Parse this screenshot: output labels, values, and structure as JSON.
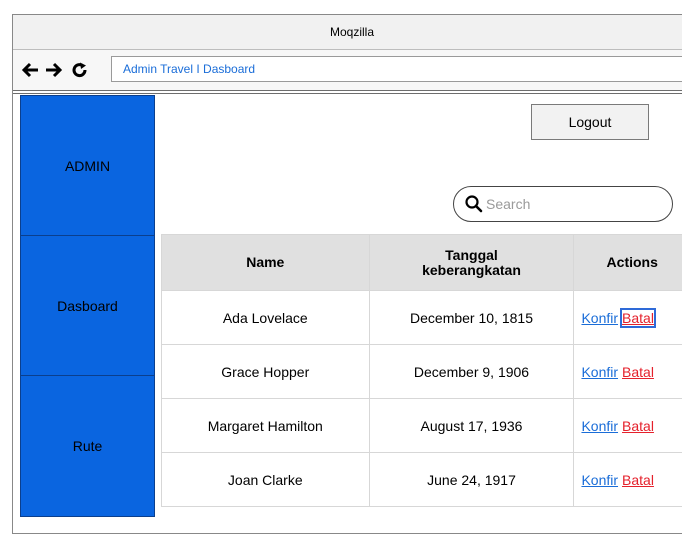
{
  "window": {
    "title": "Moqzilla"
  },
  "nav": {
    "back_icon": "back-arrow-icon",
    "forward_icon": "forward-arrow-icon",
    "reload_icon": "reload-icon",
    "address": "Admin Travel I Dasboard"
  },
  "sidebar": {
    "items": [
      {
        "label": "ADMIN"
      },
      {
        "label": "Dasboard"
      },
      {
        "label": "Rute"
      }
    ],
    "color": "#0a65e0"
  },
  "header": {
    "logout_label": "Logout"
  },
  "search": {
    "placeholder": "Search",
    "value": ""
  },
  "table": {
    "columns": [
      "Name",
      "Tanggal keberangkatan",
      "Actions"
    ],
    "rows": [
      {
        "name": "Ada Lovelace",
        "date": "December 10, 1815",
        "confirm": "Konfir",
        "cancel": "Batal"
      },
      {
        "name": "Grace Hopper",
        "date": "December 9, 1906",
        "confirm": "Konfir",
        "cancel": "Batal"
      },
      {
        "name": "Margaret Hamilton",
        "date": "August 17, 1936",
        "confirm": "Konfir",
        "cancel": "Batal"
      },
      {
        "name": "Joan Clarke",
        "date": "June 24, 1917",
        "confirm": "Konfir",
        "cancel": "Batal"
      }
    ]
  },
  "colors": {
    "link": "#1a6dd8",
    "cancel": "#e5212c"
  }
}
